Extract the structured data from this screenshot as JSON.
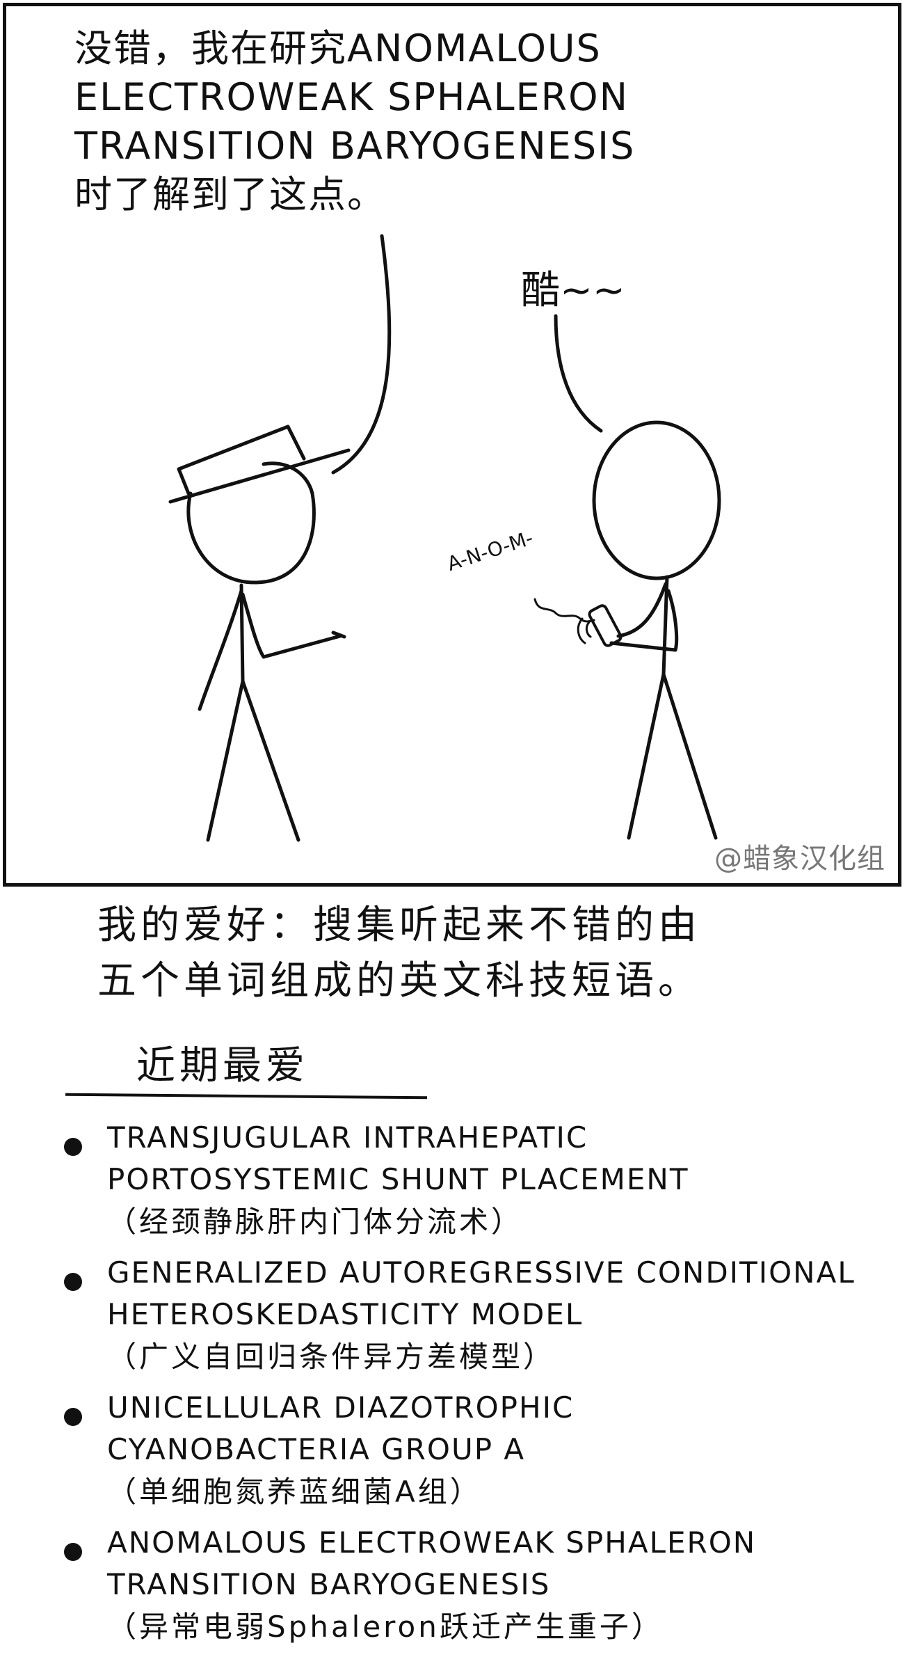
{
  "panel": {
    "speech_left_lines": [
      "没错，我在研究ANOMALOUS",
      "ELECTROWEAK SPHALERON",
      "TRANSITION BARYOGENESIS",
      "时了解到了这点。"
    ],
    "speech_right": "酷~~",
    "phone_typing": "A-N-O-M-",
    "watermark": "@蜡象汉化组"
  },
  "caption": {
    "lines": [
      "我的爱好：搜集听起来不错的由",
      "五个单词组成的英文科技短语。"
    ]
  },
  "favorites": {
    "heading": "近期最爱",
    "items": [
      {
        "en_lines": [
          "TRANSJUGULAR INTRAHEPATIC",
          "PORTOSYSTEMIC SHUNT PLACEMENT"
        ],
        "zh": "（经颈静脉肝内门体分流术）"
      },
      {
        "en_lines": [
          "GENERALIZED AUTOREGRESSIVE CONDITIONAL",
          "HETEROSKEDASTICITY MODEL"
        ],
        "zh": "（广义自回归条件异方差模型）"
      },
      {
        "en_lines": [
          "UNICELLULAR DIAZOTROPHIC",
          "CYANOBACTERIA GROUP A"
        ],
        "zh": "（单细胞氮养蓝细菌A组）"
      },
      {
        "en_lines": [
          "ANOMALOUS ELECTROWEAK SPHALERON",
          "TRANSITION BARYOGENESIS"
        ],
        "zh": "（异常电弱Sphaleron跃迁产生重子）"
      }
    ]
  }
}
